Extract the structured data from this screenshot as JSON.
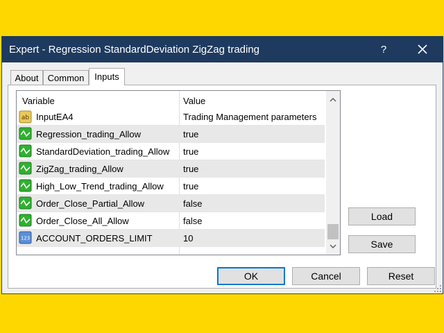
{
  "window": {
    "title": "Expert - Regression StandardDeviation ZigZag trading",
    "help_label": "?"
  },
  "tabs": [
    {
      "label": "About",
      "active": false
    },
    {
      "label": "Common",
      "active": false
    },
    {
      "label": "Inputs",
      "active": true
    }
  ],
  "grid": {
    "columns": [
      "Variable",
      "Value"
    ],
    "rows": [
      {
        "icon": "text-input-icon",
        "icon_text": "ab",
        "variable": "InputEA4",
        "value": "Trading Management parameters"
      },
      {
        "icon": "bool-input-icon",
        "variable": "Regression_trading_Allow",
        "value": "true"
      },
      {
        "icon": "bool-input-icon",
        "variable": "StandardDeviation_trading_Allow",
        "value": "true"
      },
      {
        "icon": "bool-input-icon",
        "variable": "ZigZag_trading_Allow",
        "value": "true"
      },
      {
        "icon": "bool-input-icon",
        "variable": "High_Low_Trend_trading_Allow",
        "value": "true"
      },
      {
        "icon": "bool-input-icon",
        "variable": "Order_Close_Partial_Allow",
        "value": "false"
      },
      {
        "icon": "bool-input-icon",
        "variable": "Order_Close_All_Allow",
        "value": "false"
      },
      {
        "icon": "number-input-icon",
        "icon_text": "123",
        "variable": "ACCOUNT_ORDERS_LIMIT",
        "value": "10"
      }
    ]
  },
  "side_buttons": {
    "load": "Load",
    "save": "Save"
  },
  "footer_buttons": {
    "ok": "OK",
    "cancel": "Cancel",
    "reset": "Reset"
  },
  "colors": {
    "titlebar": "#1e3a5f",
    "background": "#ffd700",
    "default_button_border": "#0078d7",
    "bool_icon_green": "#2fb12f"
  }
}
